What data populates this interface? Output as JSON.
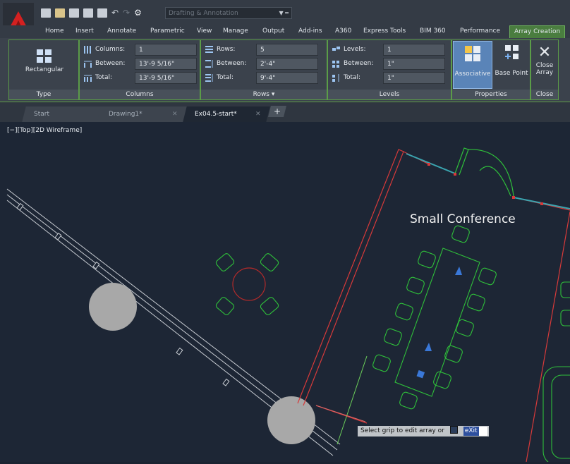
{
  "quick_access": {
    "workspace_value": "Drafting & Annotation",
    "icons": [
      "new-icon",
      "open-icon",
      "save-icon",
      "saveas-icon",
      "print-icon",
      "undo-icon",
      "redo-icon"
    ]
  },
  "ribbon_tabs": [
    "Home",
    "Insert",
    "Annotate",
    "Parametric",
    "View",
    "Manage",
    "Output",
    "Add-ins",
    "A360",
    "Express Tools",
    "BIM 360",
    "Performance",
    "Array Creation"
  ],
  "ribbon": {
    "type_panel": {
      "button": "Rectangular",
      "title": "Type"
    },
    "columns_panel": {
      "title": "Columns",
      "columns_label": "Columns:",
      "columns_value": "1",
      "between_label": "Between:",
      "between_value": "13'-9 5/16\"",
      "total_label": "Total:",
      "total_value": "13'-9 5/16\""
    },
    "rows_panel": {
      "title": "Rows ▾",
      "rows_label": "Rows:",
      "rows_value": "5",
      "between_label": "Between:",
      "between_value": "2'-4\"",
      "total_label": "Total:",
      "total_value": "9'-4\""
    },
    "levels_panel": {
      "title": "Levels",
      "levels_label": "Levels:",
      "levels_value": "1",
      "between_label": "Between:",
      "between_value": "1\"",
      "total_label": "Total:",
      "total_value": "1\""
    },
    "properties_panel": {
      "title": "Properties",
      "associative": "Associative",
      "base_point": "Base Point"
    },
    "close_panel": {
      "title": "Close",
      "close_line1": "Close",
      "close_line2": "Array"
    }
  },
  "doc_tabs": {
    "start": "Start",
    "drawing1": "Drawing1*",
    "ex": "Ex04.5-start*"
  },
  "viewport_label": "[−][Top][2D Wireframe]",
  "drawing": {
    "room_label": "Small Conference"
  },
  "tooltip": {
    "text": "Select grip to edit array or",
    "input": "eXit"
  },
  "colors": {
    "accent_green": "#4a7d3f",
    "wall_red": "#d83a3a",
    "furniture_green": "#2fbf3a",
    "grip_blue": "#3a78d8",
    "column_gray": "#a8a8a8"
  }
}
